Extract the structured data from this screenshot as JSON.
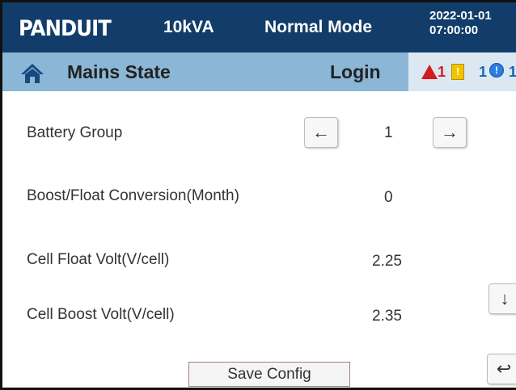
{
  "header": {
    "logo_text": "PANDUIT",
    "rating": "10kVA",
    "mode": "Normal Mode",
    "date": "2022-01-01",
    "time": "07:00:00"
  },
  "subheader": {
    "title": "Mains State",
    "login": "Login",
    "alarms": {
      "critical": "1",
      "warning": "1",
      "info": "1"
    }
  },
  "settings": {
    "battery_group": {
      "label": "Battery Group",
      "value": "1"
    },
    "boost_float": {
      "label": "Boost/Float Conversion(Month)",
      "value": "0"
    },
    "cell_float": {
      "label": "Cell Float Volt(V/cell)",
      "value": "2.25"
    },
    "cell_boost": {
      "label": "Cell Boost Volt(V/cell)",
      "value": "2.35"
    }
  },
  "buttons": {
    "prev_glyph": "←",
    "next_glyph": "→",
    "scroll_down_glyph": "↓",
    "back_glyph": "↩",
    "save_label": "Save Config"
  },
  "colors": {
    "topbar": "#123d6a",
    "subbar": "#8bb6d6",
    "alarm_critical": "#d71920",
    "alarm_warning": "#f2c300",
    "alarm_info": "#2a7ee0"
  }
}
